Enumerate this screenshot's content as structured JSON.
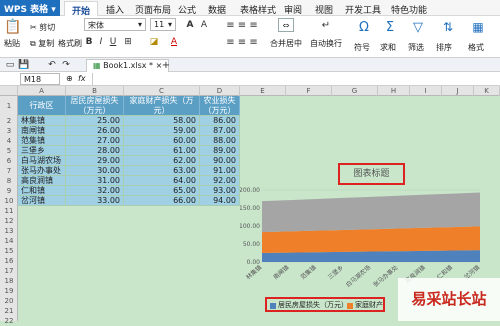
{
  "app": {
    "title": "WPS 表格"
  },
  "ribbon_tabs": [
    "开始",
    "插入",
    "页面布局",
    "公式",
    "数据",
    "表格样式",
    "审阅",
    "视图",
    "开发工具",
    "特色功能"
  ],
  "toolbar": {
    "paste": "粘贴",
    "cut": "剪切",
    "copy": "复制",
    "format_painter": "格式刷",
    "font_name": "宋体",
    "font_size": "11",
    "merge_center": "合并居中",
    "auto_wrap": "自动换行",
    "symbol": "符号",
    "sum": "求和",
    "filter": "筛选",
    "sort": "排序",
    "format": "格式"
  },
  "doc": {
    "tab_title": "Book1.xlsx *"
  },
  "formula": {
    "name_box": "M18",
    "fx": "fx"
  },
  "columns": [
    "A",
    "B",
    "C",
    "D",
    "E",
    "F",
    "G",
    "H",
    "I",
    "J",
    "K"
  ],
  "rows": [
    "1",
    "2",
    "3",
    "4",
    "5",
    "6",
    "7",
    "8",
    "9",
    "10",
    "11",
    "12",
    "13",
    "14",
    "15",
    "16",
    "17",
    "18",
    "19",
    "20",
    "21",
    "22"
  ],
  "table": {
    "headers": [
      "行政区",
      "居民房屋损失（万元）",
      "家庭财产损失（万元）",
      "农业损失（万元）"
    ],
    "rows": [
      [
        "林集镇",
        "25.00",
        "58.00",
        "86.00"
      ],
      [
        "南闸镇",
        "26.00",
        "59.00",
        "87.00"
      ],
      [
        "范集镇",
        "27.00",
        "60.00",
        "88.00"
      ],
      [
        "三堡乡",
        "28.00",
        "61.00",
        "89.00"
      ],
      [
        "白马湖农场",
        "29.00",
        "62.00",
        "90.00"
      ],
      [
        "张马办事处",
        "30.00",
        "63.00",
        "91.00"
      ],
      [
        "高良涧镇",
        "31.00",
        "64.00",
        "92.00"
      ],
      [
        "仁和镇",
        "32.00",
        "65.00",
        "93.00"
      ],
      [
        "岔河镇",
        "33.00",
        "66.00",
        "94.00"
      ]
    ]
  },
  "chart_data": {
    "type": "area",
    "title": "图表标题",
    "categories": [
      "林集镇",
      "南闸镇",
      "范集镇",
      "三堡乡",
      "白马湖农场",
      "张马办事处",
      "高良涧镇",
      "仁和镇",
      "岔河镇"
    ],
    "series": [
      {
        "name": "居民房屋损失（万元）",
        "values": [
          25,
          26,
          27,
          28,
          29,
          30,
          31,
          32,
          33
        ],
        "color": "#4f81bd"
      },
      {
        "name": "家庭财产损失（万元）",
        "values": [
          58,
          59,
          60,
          61,
          62,
          63,
          64,
          65,
          66
        ],
        "color": "#f07f2a"
      },
      {
        "name": "农业损失（万元）",
        "values": [
          86,
          87,
          88,
          89,
          90,
          91,
          92,
          93,
          94
        ],
        "color": "#a5a5a5"
      }
    ],
    "yticks": [
      "200.00",
      "150.00",
      "100.00",
      "50.00",
      "0.00"
    ],
    "ylim": [
      0,
      200
    ],
    "stacked": true,
    "legend_labels": [
      "居民房屋损失（万元）",
      "家庭财产"
    ]
  },
  "watermark": "易采站长站",
  "colors": {
    "accent": "#1f6fbf",
    "table_header": "#5b9fc5",
    "table_row": "#9fd0e4",
    "highlight": "#dd2222"
  }
}
